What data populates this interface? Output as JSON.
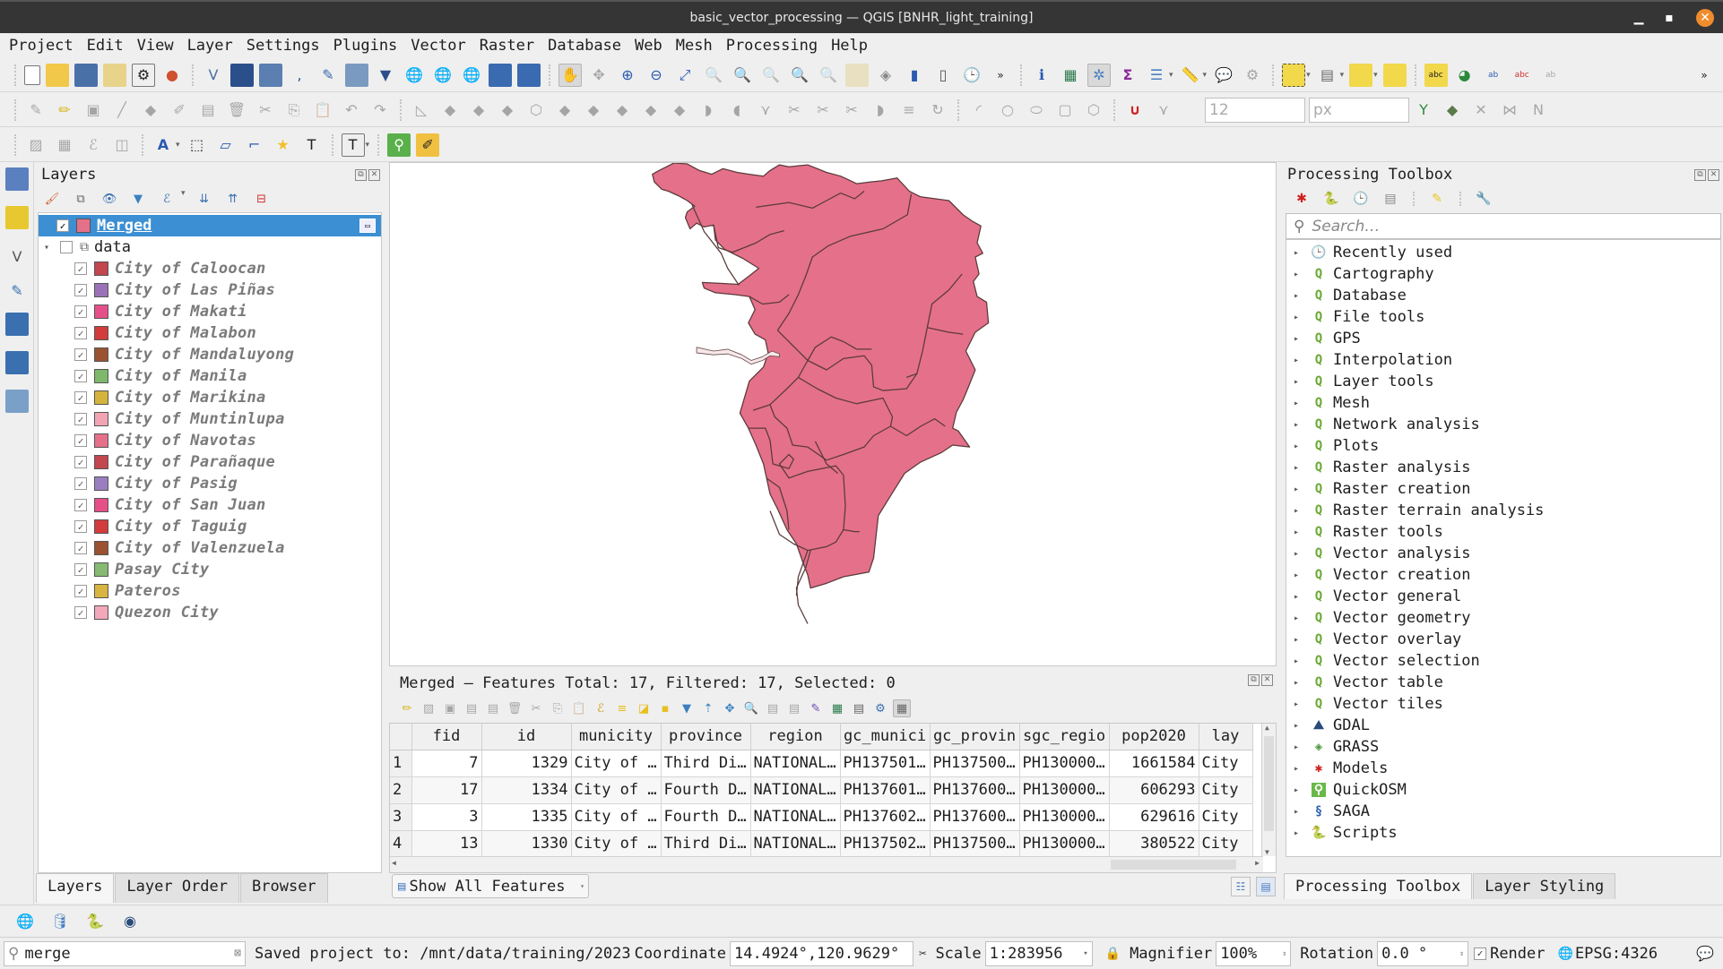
{
  "window": {
    "title": "basic_vector_processing — QGIS [BNHR_light_training]"
  },
  "menu": [
    "Project",
    "Edit",
    "View",
    "Layer",
    "Settings",
    "Plugins",
    "Vector",
    "Raster",
    "Database",
    "Web",
    "Mesh",
    "Processing",
    "Help"
  ],
  "toolbars": {
    "snapping_size": "12",
    "snapping_unit": "px"
  },
  "layers_panel": {
    "title": "Layers",
    "merged_layer": {
      "name": "Merged",
      "color": "#e5708a",
      "checked": true
    },
    "group": {
      "name": "data",
      "checked": false,
      "expanded": true
    },
    "sublayers": [
      {
        "name": "City of Caloocan",
        "color": "#c2474f"
      },
      {
        "name": "City of Las Piñas",
        "color": "#9b72b8"
      },
      {
        "name": "City of Makati",
        "color": "#e5508a"
      },
      {
        "name": "City of Malabon",
        "color": "#d23c3c"
      },
      {
        "name": "City of Mandaluyong",
        "color": "#9a5230"
      },
      {
        "name": "City of Manila",
        "color": "#7db86b"
      },
      {
        "name": "City of Marikina",
        "color": "#d4b43c"
      },
      {
        "name": "City of Muntinlupa",
        "color": "#f2a4b4"
      },
      {
        "name": "City of Navotas",
        "color": "#e5708a"
      },
      {
        "name": "City of Parañaque",
        "color": "#c2474f"
      },
      {
        "name": "City of Pasig",
        "color": "#9b7ec0"
      },
      {
        "name": "City of San Juan",
        "color": "#e55088"
      },
      {
        "name": "City of Taguig",
        "color": "#d23c3c"
      },
      {
        "name": "City of Valenzuela",
        "color": "#9a5230"
      },
      {
        "name": "Pasay City",
        "color": "#86ba72"
      },
      {
        "name": "Pateros",
        "color": "#d8b440"
      },
      {
        "name": "Quezon City",
        "color": "#f2a8b8"
      }
    ],
    "tabs": [
      "Layers",
      "Layer Order",
      "Browser"
    ]
  },
  "map": {
    "fill_color": "#e5708a",
    "stroke_color": "#5a3a3a"
  },
  "attribute_table": {
    "title": "Merged — Features Total: 17, Filtered: 17, Selected: 0",
    "columns": [
      "fid",
      "id",
      "municity",
      "province",
      "region",
      "gc_munici",
      "gc_provin",
      "sgc_regio",
      "pop2020",
      "lay"
    ],
    "rows": [
      {
        "n": "1",
        "cells": [
          "7",
          "1329",
          "City of …",
          "Third Di…",
          "NATIONAL…",
          "PH137501…",
          "PH137500…",
          "PH130000…",
          "1661584",
          "City"
        ]
      },
      {
        "n": "2",
        "cells": [
          "17",
          "1334",
          "City of …",
          "Fourth D…",
          "NATIONAL…",
          "PH137601…",
          "PH137600…",
          "PH130000…",
          "606293",
          "City"
        ]
      },
      {
        "n": "3",
        "cells": [
          "3",
          "1335",
          "City of …",
          "Fourth D…",
          "NATIONAL…",
          "PH137602…",
          "PH137600…",
          "PH130000…",
          "629616",
          "City"
        ]
      },
      {
        "n": "4",
        "cells": [
          "13",
          "1330",
          "City of …",
          "Third Di…",
          "NATIONAL…",
          "PH137502…",
          "PH137500…",
          "PH130000…",
          "380522",
          "City"
        ]
      }
    ],
    "filter_button": "Show All Features"
  },
  "processing_toolbox": {
    "title": "Processing Toolbox",
    "search_placeholder": "Search…",
    "items": [
      {
        "label": "Recently used",
        "icon": "clock"
      },
      {
        "label": "Cartography",
        "icon": "qgis"
      },
      {
        "label": "Database",
        "icon": "qgis"
      },
      {
        "label": "File tools",
        "icon": "qgis"
      },
      {
        "label": "GPS",
        "icon": "qgis"
      },
      {
        "label": "Interpolation",
        "icon": "qgis"
      },
      {
        "label": "Layer tools",
        "icon": "qgis"
      },
      {
        "label": "Mesh",
        "icon": "qgis"
      },
      {
        "label": "Network analysis",
        "icon": "qgis"
      },
      {
        "label": "Plots",
        "icon": "qgis"
      },
      {
        "label": "Raster analysis",
        "icon": "qgis"
      },
      {
        "label": "Raster creation",
        "icon": "qgis"
      },
      {
        "label": "Raster terrain analysis",
        "icon": "qgis"
      },
      {
        "label": "Raster tools",
        "icon": "qgis"
      },
      {
        "label": "Vector analysis",
        "icon": "qgis"
      },
      {
        "label": "Vector creation",
        "icon": "qgis"
      },
      {
        "label": "Vector general",
        "icon": "qgis"
      },
      {
        "label": "Vector geometry",
        "icon": "qgis"
      },
      {
        "label": "Vector overlay",
        "icon": "qgis"
      },
      {
        "label": "Vector selection",
        "icon": "qgis"
      },
      {
        "label": "Vector table",
        "icon": "qgis"
      },
      {
        "label": "Vector tiles",
        "icon": "qgis"
      },
      {
        "label": "GDAL",
        "icon": "gdal"
      },
      {
        "label": "GRASS",
        "icon": "grass"
      },
      {
        "label": "Models",
        "icon": "models"
      },
      {
        "label": "QuickOSM",
        "icon": "quickosm"
      },
      {
        "label": "SAGA",
        "icon": "saga"
      },
      {
        "label": "Scripts",
        "icon": "python"
      }
    ],
    "tabs": [
      "Processing Toolbox",
      "Layer Styling"
    ]
  },
  "statusbar": {
    "locator_value": "merge",
    "message": "Saved project to: /mnt/data/training/2023",
    "coordinate_label": "Coordinate",
    "coordinate_value": "14.4924°,120.9629°",
    "scale_label": "Scale",
    "scale_value": "1:283956",
    "magnifier_label": "Magnifier",
    "magnifier_value": "100%",
    "rotation_label": "Rotation",
    "rotation_value": "0.0 °",
    "render_label": "Render",
    "render_checked": true,
    "crs": "EPSG:4326"
  }
}
